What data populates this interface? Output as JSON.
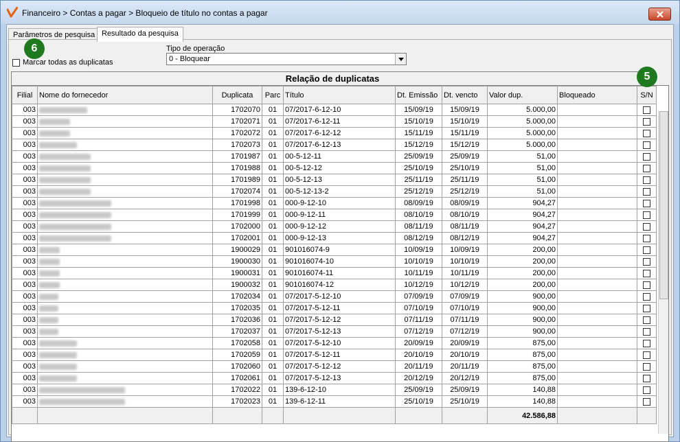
{
  "window": {
    "title": "Financeiro > Contas a pagar > Bloqueio de título no contas a pagar"
  },
  "tabs": [
    {
      "label": "Parâmetros de pesquisa"
    },
    {
      "label": "Resultado da pesquisa"
    }
  ],
  "badges": {
    "select_all": "6",
    "sn_column": "5"
  },
  "check_all": {
    "label": "Marcar todas as duplicatas",
    "checked": false
  },
  "operation": {
    "label": "Tipo de operação",
    "value": "0 - Bloquear"
  },
  "grid": {
    "title": "Relação de duplicatas",
    "columns": [
      "Filial",
      "Nome do fornecedor",
      "Duplicata",
      "Parc",
      "Título",
      "Dt. Emissão",
      "Dt. vencto",
      "Valor dup.",
      "Bloqueado",
      "S/N"
    ],
    "rows": [
      [
        "003",
        "",
        "1702070",
        "01",
        "07/2017-6-12-10",
        "15/09/19",
        "15/09/19",
        "5.000,00",
        ""
      ],
      [
        "003",
        "",
        "1702071",
        "01",
        "07/2017-6-12-11",
        "15/10/19",
        "15/10/19",
        "5.000,00",
        ""
      ],
      [
        "003",
        "",
        "1702072",
        "01",
        "07/2017-6-12-12",
        "15/11/19",
        "15/11/19",
        "5.000,00",
        ""
      ],
      [
        "003",
        "",
        "1702073",
        "01",
        "07/2017-6-12-13",
        "15/12/19",
        "15/12/19",
        "5.000,00",
        ""
      ],
      [
        "003",
        "",
        "1701987",
        "01",
        "00-5-12-11",
        "25/09/19",
        "25/09/19",
        "51,00",
        ""
      ],
      [
        "003",
        "",
        "1701988",
        "01",
        "00-5-12-12",
        "25/10/19",
        "25/10/19",
        "51,00",
        ""
      ],
      [
        "003",
        "",
        "1701989",
        "01",
        "00-5-12-13",
        "25/11/19",
        "25/11/19",
        "51,00",
        ""
      ],
      [
        "003",
        "",
        "1702074",
        "01",
        "00-5-12-13-2",
        "25/12/19",
        "25/12/19",
        "51,00",
        ""
      ],
      [
        "003",
        "",
        "1701998",
        "01",
        "000-9-12-10",
        "08/09/19",
        "08/09/19",
        "904,27",
        ""
      ],
      [
        "003",
        "",
        "1701999",
        "01",
        "000-9-12-11",
        "08/10/19",
        "08/10/19",
        "904,27",
        ""
      ],
      [
        "003",
        "",
        "1702000",
        "01",
        "000-9-12-12",
        "08/11/19",
        "08/11/19",
        "904,27",
        ""
      ],
      [
        "003",
        "",
        "1702001",
        "01",
        "000-9-12-13",
        "08/12/19",
        "08/12/19",
        "904,27",
        ""
      ],
      [
        "003",
        "",
        "1900029",
        "01",
        "901016074-9",
        "10/09/19",
        "10/09/19",
        "200,00",
        ""
      ],
      [
        "003",
        "",
        "1900030",
        "01",
        "901016074-10",
        "10/10/19",
        "10/10/19",
        "200,00",
        ""
      ],
      [
        "003",
        "",
        "1900031",
        "01",
        "901016074-11",
        "10/11/19",
        "10/11/19",
        "200,00",
        ""
      ],
      [
        "003",
        "",
        "1900032",
        "01",
        "901016074-12",
        "10/12/19",
        "10/12/19",
        "200,00",
        ""
      ],
      [
        "003",
        "",
        "1702034",
        "01",
        "07/2017-5-12-10",
        "07/09/19",
        "07/09/19",
        "900,00",
        ""
      ],
      [
        "003",
        "",
        "1702035",
        "01",
        "07/2017-5-12-11",
        "07/10/19",
        "07/10/19",
        "900,00",
        ""
      ],
      [
        "003",
        "",
        "1702036",
        "01",
        "07/2017-5-12-12",
        "07/11/19",
        "07/11/19",
        "900,00",
        ""
      ],
      [
        "003",
        "",
        "1702037",
        "01",
        "07/2017-5-12-13",
        "07/12/19",
        "07/12/19",
        "900,00",
        ""
      ],
      [
        "003",
        "",
        "1702058",
        "01",
        "07/2017-5-12-10",
        "20/09/19",
        "20/09/19",
        "875,00",
        ""
      ],
      [
        "003",
        "",
        "1702059",
        "01",
        "07/2017-5-12-11",
        "20/10/19",
        "20/10/19",
        "875,00",
        ""
      ],
      [
        "003",
        "",
        "1702060",
        "01",
        "07/2017-5-12-12",
        "20/11/19",
        "20/11/19",
        "875,00",
        ""
      ],
      [
        "003",
        "",
        "1702061",
        "01",
        "07/2017-5-12-13",
        "20/12/19",
        "20/12/19",
        "875,00",
        ""
      ],
      [
        "003",
        "",
        "1702022",
        "01",
        "139-6-12-10",
        "25/09/19",
        "25/09/19",
        "140,88",
        ""
      ],
      [
        "003",
        "",
        "1702023",
        "01",
        "139-6-12-11",
        "25/10/19",
        "25/10/19",
        "140,88",
        ""
      ]
    ],
    "total_value": "42.586,88"
  },
  "colors": {
    "badge": "#1f7a1f",
    "logo": "#e8620c",
    "close_button": "#c8472a"
  }
}
